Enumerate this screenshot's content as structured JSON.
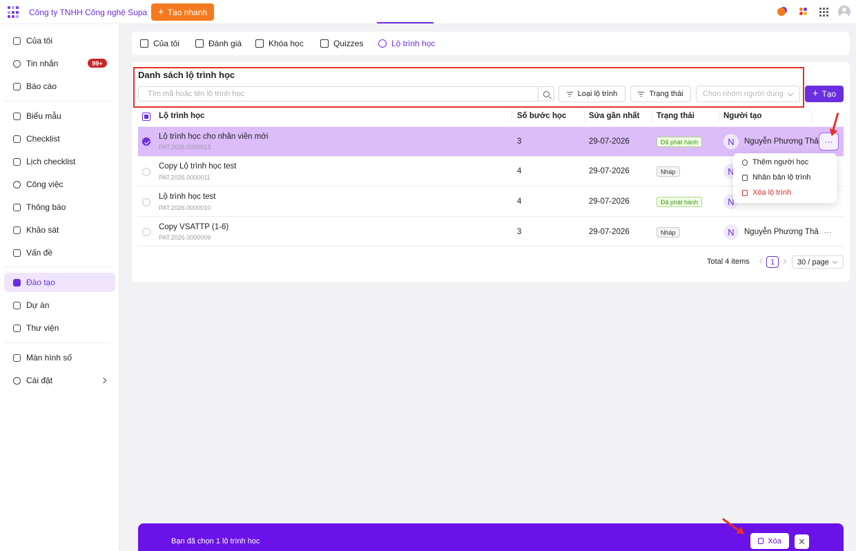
{
  "topbar": {
    "company": "Công ty TNHH Công nghệ Supa",
    "quick_create": "Tạo nhanh"
  },
  "sidebar": {
    "items": [
      {
        "label": "Của tôi",
        "icon": "person-icon"
      },
      {
        "label": "Tin nhắn",
        "icon": "chat-icon",
        "badge": "99+"
      },
      {
        "label": "Báo cáo",
        "icon": "report-icon"
      },
      {
        "label": "Biểu mẫu",
        "icon": "form-icon"
      },
      {
        "label": "Checklist",
        "icon": "checklist-icon"
      },
      {
        "label": "Lịch checklist",
        "icon": "calendar-icon"
      },
      {
        "label": "Công việc",
        "icon": "task-icon"
      },
      {
        "label": "Thông báo",
        "icon": "bell-icon"
      },
      {
        "label": "Khảo sát",
        "icon": "survey-icon"
      },
      {
        "label": "Vấn đề",
        "icon": "issue-icon"
      },
      {
        "label": "Đào tạo",
        "icon": "training-icon",
        "active": true
      },
      {
        "label": "Dự án",
        "icon": "project-icon"
      },
      {
        "label": "Thư viện",
        "icon": "library-icon"
      },
      {
        "label": "Màn hình số",
        "icon": "screen-icon"
      },
      {
        "label": "Cài đặt",
        "icon": "settings-icon"
      }
    ]
  },
  "tabs": [
    {
      "label": "Của tôi",
      "icon": "person-icon"
    },
    {
      "label": "Đánh giá",
      "icon": "check-icon"
    },
    {
      "label": "Khóa học",
      "icon": "graduation-cap-icon"
    },
    {
      "label": "Quizzes",
      "icon": "quiz-icon"
    },
    {
      "label": "Lộ trình học",
      "icon": "route-icon",
      "active": true
    }
  ],
  "list": {
    "title": "Danh sách lộ trình học",
    "search_placeholder": "Tìm mã hoặc tên lộ trình học",
    "filter_type": "Loại lộ trình",
    "filter_status": "Trạng thái",
    "group_placeholder": "Chọn nhóm người dùng",
    "create": "Tạo"
  },
  "table": {
    "headers": {
      "name": "Lộ trình học",
      "steps": "Số bước học",
      "modified": "Sửa gần nhất",
      "status": "Trạng thái",
      "creator": "Người tạo"
    },
    "rows": [
      {
        "name": "Lộ trình học cho nhân viên mới",
        "code": "PAT.2026.0000013",
        "steps": "3",
        "modified": "29-07-2026",
        "status": "Đã phát hành",
        "avatar": "N",
        "creator": "Nguyễn Phương Thả",
        "selected": true
      },
      {
        "name": "Copy Lộ trình học test",
        "code": "PAT.2026.0000011",
        "steps": "4",
        "modified": "29-07-2026",
        "status": "Nháp",
        "avatar": "N",
        "creator": ""
      },
      {
        "name": "Lộ trình học test",
        "code": "PAT.2026.0000010",
        "steps": "4",
        "modified": "29-07-2026",
        "status": "Đã phát hành",
        "avatar": "N",
        "creator": ""
      },
      {
        "name": "Copy VSATTP (1-6)",
        "code": "PAT.2026.0000009",
        "steps": "3",
        "modified": "29-07-2026",
        "status": "Nháp",
        "avatar": "N",
        "creator": "Nguyễn Phương Thả"
      }
    ],
    "more": "···"
  },
  "menu": {
    "add_learner": "Thêm người học",
    "duplicate": "Nhân bản lộ trình",
    "delete": "Xóa lộ trình"
  },
  "pagination": {
    "total": "Total 4 items",
    "current_page": "1",
    "page_size": "30 / page"
  },
  "bottom_bar": {
    "text": "Bạn đã chọn 1 lộ trình học",
    "delete": "Xóa",
    "close": "✕"
  },
  "colors": {
    "accent": "#6a2ee0",
    "quick_create": "#f47a1f",
    "selected_row": "#dcbcf9",
    "annotation": "#e53226"
  }
}
